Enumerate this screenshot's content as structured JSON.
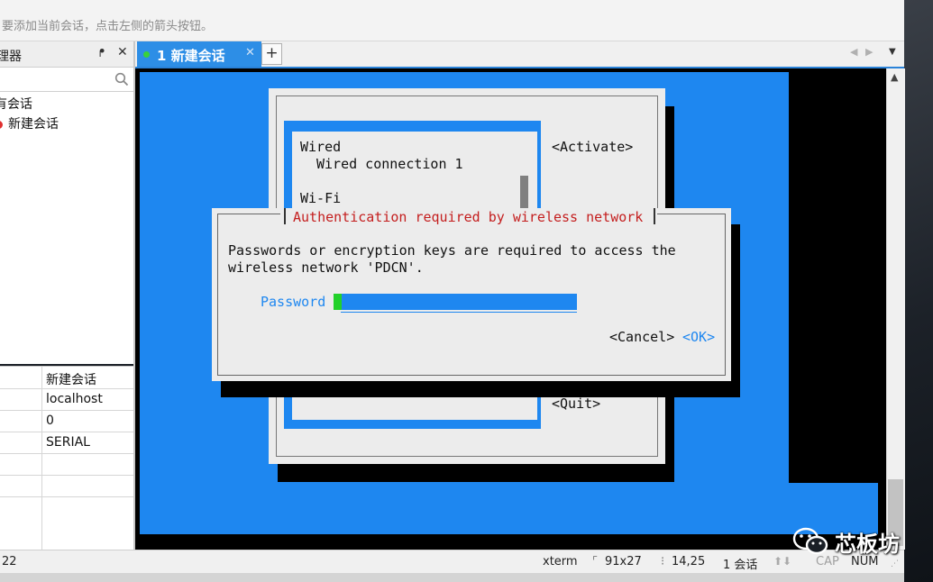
{
  "hint_bar": {
    "text": "要添加当前会话，点击左侧的箭头按钮。"
  },
  "session_manager": {
    "title": "理器",
    "pin": "ᖰ",
    "close": "✕",
    "tree": [
      {
        "label": "有会话"
      },
      {
        "label": "新建会话"
      }
    ],
    "properties": [
      "新建会话",
      "localhost",
      "0",
      "SERIAL",
      "",
      "",
      ""
    ]
  },
  "tabs": {
    "items": [
      {
        "label": "1 新建会话",
        "close": "✕"
      }
    ],
    "add": "+",
    "nav_left": "◀",
    "nav_right": "▶",
    "nav_menu": "▼"
  },
  "terminal": {
    "list": {
      "wired_header": "Wired",
      "wired_item": "Wired connection 1",
      "wifi_header": "Wi-Fi"
    },
    "activate": "<Activate>",
    "quit": "<Quit>",
    "dialog": {
      "title": "Authentication required by wireless network",
      "message_line1": "Passwords or encryption keys are required to access the",
      "message_line2": "wireless network 'PDCN'.",
      "password_label": "Password",
      "cancel": "<Cancel>",
      "ok": "<OK>"
    },
    "colors": {
      "blue": "#1e87f0",
      "title_red": "#c41e1e",
      "cursor_green": "#22d12a"
    }
  },
  "status_bar": {
    "left": "22",
    "term_type": "xterm",
    "size": "91x27",
    "position": "14,25",
    "sessions": "1 会话",
    "cap": "CAP",
    "num": "NUM"
  },
  "watermark": {
    "text": "芯板坊"
  }
}
